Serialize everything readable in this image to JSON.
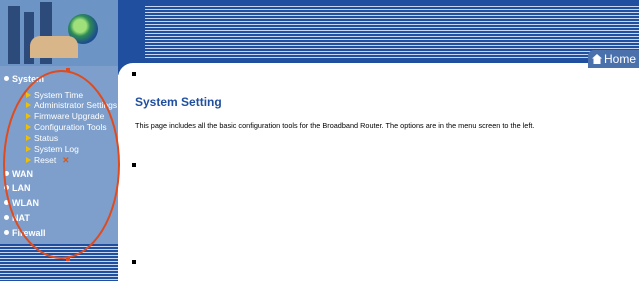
{
  "header": {
    "home_label": "Home"
  },
  "sidebar": {
    "system": {
      "label": "System",
      "items": [
        "System Time",
        "Administrator Settings",
        "Firmware Upgrade",
        "Configuration Tools",
        "Status",
        "System Log",
        "Reset"
      ]
    },
    "sections": [
      "WAN",
      "LAN",
      "WLAN",
      "NAT",
      "Firewall"
    ]
  },
  "main": {
    "title": "System Setting",
    "description": "This page includes all the basic configuration tools for the Broadband Router. The options are in the menu screen to the left."
  },
  "colors": {
    "brand": "#1f4f9e",
    "sidebar": "#7e9fcc",
    "annotation": "#e04b1e"
  },
  "icons": {
    "home": "home-icon",
    "reset": "close-icon"
  }
}
